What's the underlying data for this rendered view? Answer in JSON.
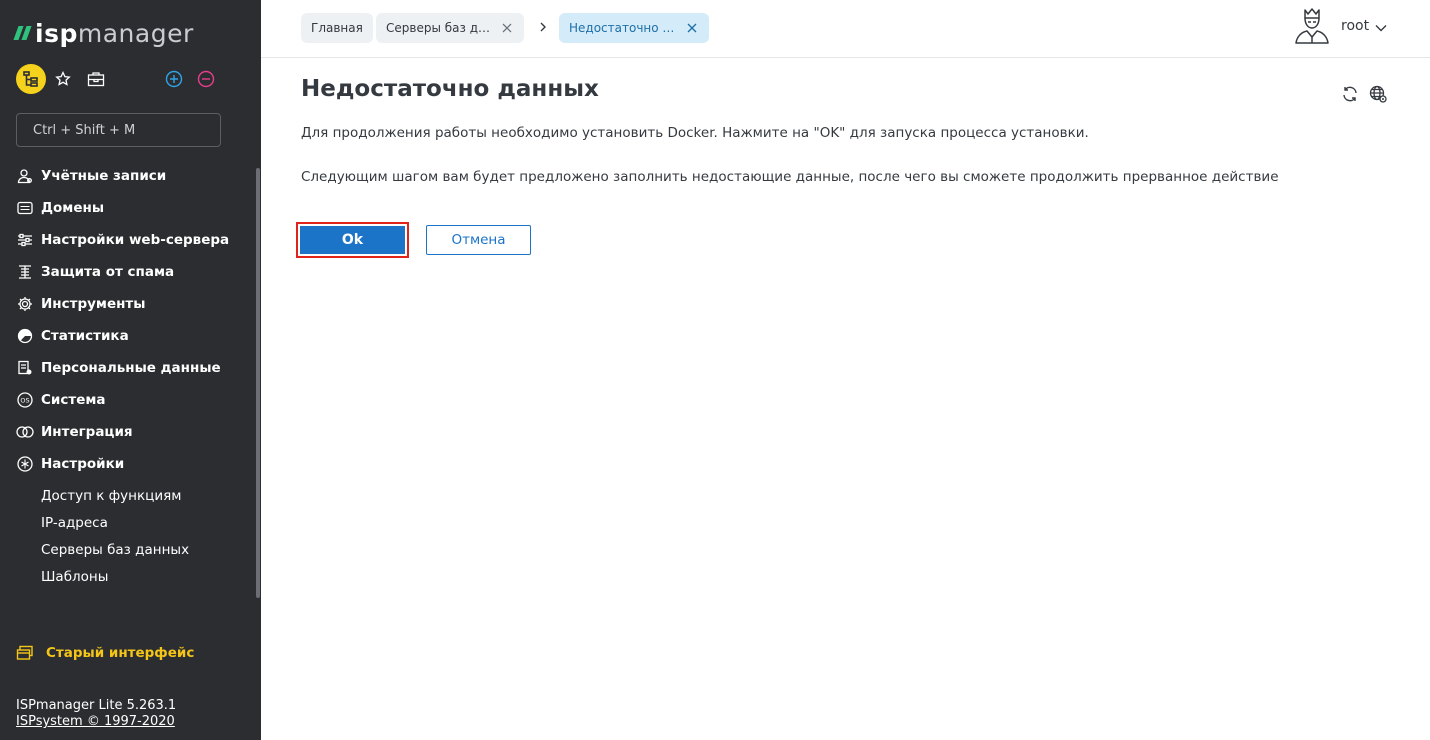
{
  "app": {
    "brand_prefix": "isp",
    "brand_suffix": "manager"
  },
  "sidebar": {
    "search_placeholder": "Ctrl + Shift + M",
    "menu": [
      {
        "label": "Учётные записи",
        "icon": "user-icon"
      },
      {
        "label": "Домены",
        "icon": "domain-icon"
      },
      {
        "label": "Настройки web-сервера",
        "icon": "sliders-icon"
      },
      {
        "label": "Защита от спама",
        "icon": "shield-icon"
      },
      {
        "label": "Инструменты",
        "icon": "gear-icon"
      },
      {
        "label": "Статистика",
        "icon": "pie-chart-icon"
      },
      {
        "label": "Персональные данные",
        "icon": "personal-data-icon"
      },
      {
        "label": "Система",
        "icon": "os-icon"
      },
      {
        "label": "Интеграция",
        "icon": "integration-icon"
      },
      {
        "label": "Настройки",
        "icon": "settings-icon"
      }
    ],
    "submenu": [
      {
        "label": "Доступ к функциям"
      },
      {
        "label": "IP-адреса"
      },
      {
        "label": "Серверы баз данных"
      },
      {
        "label": "Шаблоны"
      }
    ],
    "old_interface_label": "Старый интерфейс",
    "version_line": "ISPmanager Lite 5.263.1",
    "copyright_line": "ISPsystem © 1997-2020"
  },
  "header": {
    "breadcrumbs": [
      {
        "label": "Главная"
      },
      {
        "label": "Серверы баз данн…"
      },
      {
        "label": "Недостаточно да…"
      }
    ],
    "user_name": "root"
  },
  "main": {
    "title": "Недостаточно данных",
    "message_1": "Для продолжения работы необходимо установить Docker. Нажмите на \"OK\" для запуска процесса установки.",
    "message_2": "Следующим шагом вам будет предложено заполнить недостающие данные, после чего вы сможете продолжить прерванное действие",
    "ok_label": "Ok",
    "cancel_label": "Отмена"
  },
  "colors": {
    "sidebar_bg": "#2b2d31",
    "accent_blue": "#1b74c7",
    "logo_green": "#2ec27e",
    "old_ui_yellow": "#f5c518",
    "highlight_red": "#e2231a",
    "crumb_active_bg": "#d4ebf9"
  }
}
